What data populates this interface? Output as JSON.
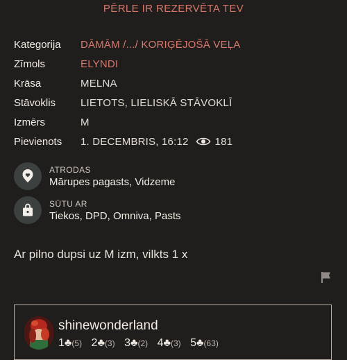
{
  "banner": "PĒRLE IR REZERVĒTA TEV",
  "details": [
    {
      "label": "Kategorija",
      "value": "DĀMĀM /.../ KORIĢĒJOŠĀ VEĻA",
      "link": true
    },
    {
      "label": "Zīmols",
      "value": "ELYNDI",
      "link": true
    },
    {
      "label": "Krāsa",
      "value": "MELNA",
      "link": false
    },
    {
      "label": "Stāvoklis",
      "value": "LIETOTS, LIELISKĀ STĀVOKLĪ",
      "link": false
    },
    {
      "label": "Izmērs",
      "value": "M",
      "link": false
    },
    {
      "label": "Pievienots",
      "value": "1. DECEMBRIS, 16:12",
      "link": false
    }
  ],
  "views": "181",
  "location": {
    "label": "ATRODAS",
    "value": "Mārupes pagasts, Vidzeme",
    "icon": "heart-pin-icon"
  },
  "shipping": {
    "label": "SŪTU AR",
    "value": "Tiekos, DPD, Omniva, Pasts",
    "icon": "bag-icon"
  },
  "description": "Ar pilno dupsi uz M izm, vilkts 1 x",
  "report_icon": "flag-icon",
  "seller": {
    "name": "shinewonderland",
    "ratings": [
      {
        "stars": "1",
        "count": "(5)"
      },
      {
        "stars": "2",
        "count": "(3)"
      },
      {
        "stars": "3",
        "count": "(2)"
      },
      {
        "stars": "4",
        "count": "(3)"
      },
      {
        "stars": "5",
        "count": "(63)"
      }
    ]
  },
  "colors": {
    "accent": "#d9776b",
    "background": "#201e1c",
    "icon_circle": "#3c413f"
  }
}
